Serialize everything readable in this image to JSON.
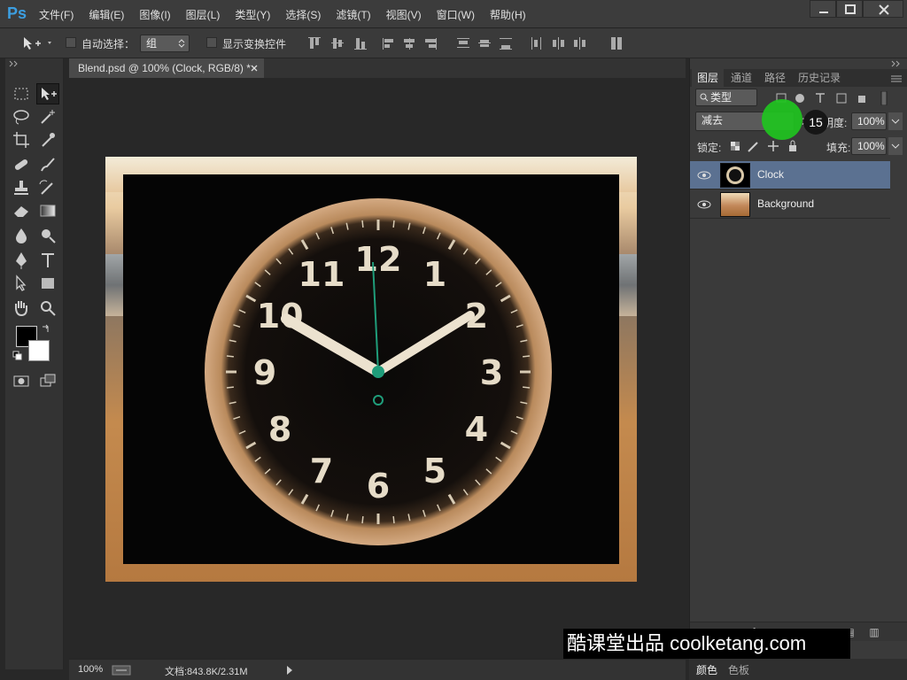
{
  "app": {
    "logo": "Ps"
  },
  "menu": [
    "文件(F)",
    "编辑(E)",
    "图像(I)",
    "图层(L)",
    "类型(Y)",
    "选择(S)",
    "滤镜(T)",
    "视图(V)",
    "窗口(W)",
    "帮助(H)"
  ],
  "options": {
    "auto_select_label": "自动选择：",
    "auto_select_value": "组",
    "show_transform_label": "显示变换控件"
  },
  "document": {
    "tab_title": "Blend.psd @ 100% (Clock, RGB/8) *",
    "zoom": "100%",
    "doc_size": "文档:843.8K/2.31M"
  },
  "layers_panel": {
    "tabs": [
      "图层",
      "通道",
      "路径",
      "历史记录"
    ],
    "filter_label": "类型",
    "blend_mode": "减去",
    "opacity_label": "不透明度:",
    "opacity_value": "100%",
    "lock_label": "锁定:",
    "fill_label": "填充:",
    "fill_value": "100%",
    "layers": [
      {
        "name": "Clock",
        "visible": true,
        "selected": true
      },
      {
        "name": "Background",
        "visible": true,
        "selected": false
      }
    ]
  },
  "bottom_tabs": [
    "颜色",
    "色板"
  ],
  "overlay": {
    "step_badge": "15"
  },
  "watermark": "酷课堂出品 coolketang.com",
  "colors": {
    "accent_selected": "#5b7191",
    "cursor_highlight": "#1fc41f"
  },
  "clock_numbers": [
    "12",
    "1",
    "2",
    "3",
    "4",
    "5",
    "6",
    "7",
    "8",
    "9",
    "10",
    "11"
  ]
}
